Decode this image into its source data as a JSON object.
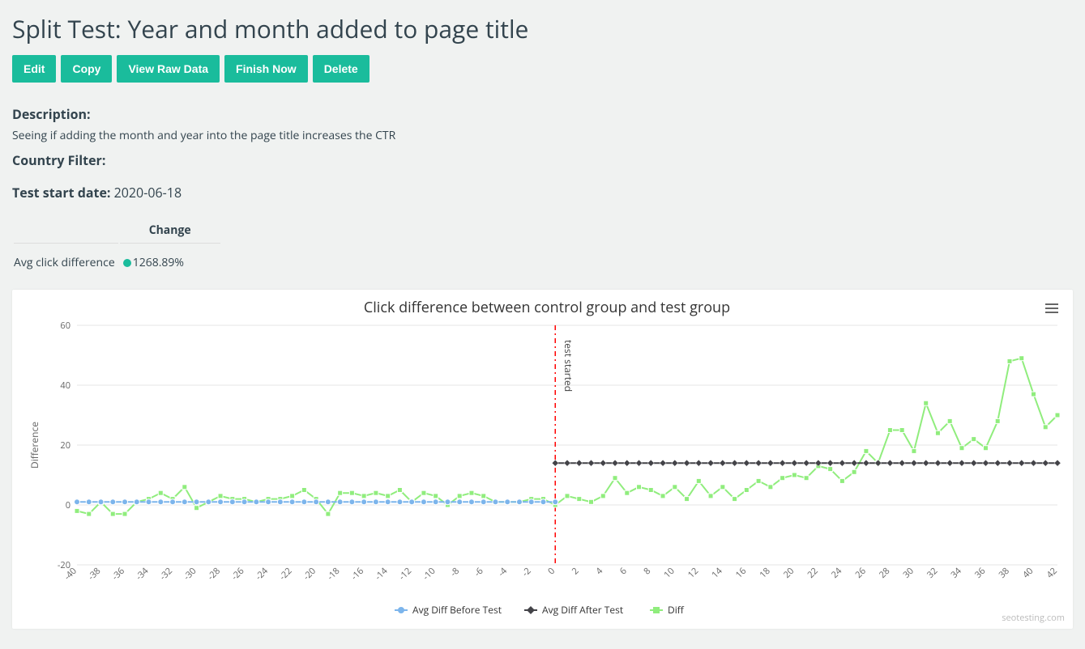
{
  "page_title": "Split Test: Year and month added to page title",
  "buttons": {
    "edit": "Edit",
    "copy": "Copy",
    "view_raw": "View Raw Data",
    "finish": "Finish Now",
    "delete": "Delete"
  },
  "description_label": "Description:",
  "description_text": "Seeing if adding the month and year into the page title increases the CTR",
  "country_filter_label": "Country Filter:",
  "country_filter_value": "",
  "start_date_label": "Test start date:",
  "start_date_value": "2020-06-18",
  "change_header": "Change",
  "avg_click_label": "Avg click difference",
  "avg_click_value": "1268.89%",
  "watermark": "seotesting.com",
  "chart_data": {
    "type": "line",
    "title": "Click difference between control group and test group",
    "ylabel": "Difference",
    "ylim": [
      -20,
      60
    ],
    "y_ticks": [
      -20,
      0,
      20,
      40,
      60
    ],
    "x": [
      -40,
      -39,
      -38,
      -37,
      -36,
      -35,
      -34,
      -33,
      -32,
      -31,
      -30,
      -29,
      -28,
      -27,
      -26,
      -25,
      -24,
      -23,
      -22,
      -21,
      -20,
      -19,
      -18,
      -17,
      -16,
      -15,
      -14,
      -13,
      -12,
      -11,
      -10,
      -9,
      -8,
      -7,
      -6,
      -5,
      -4,
      -3,
      -2,
      -1,
      0,
      1,
      2,
      3,
      4,
      5,
      6,
      7,
      8,
      9,
      10,
      11,
      12,
      13,
      14,
      15,
      16,
      17,
      18,
      19,
      20,
      21,
      22,
      23,
      24,
      25,
      26,
      27,
      28,
      29,
      30,
      31,
      32,
      33,
      34,
      35,
      36,
      37,
      38,
      39,
      40,
      41,
      42
    ],
    "x_tick_labels": [
      "-40",
      "",
      "-38",
      "",
      "-36",
      "",
      "-34",
      "",
      "-32",
      "",
      "-30",
      "",
      "-28",
      "",
      "-26",
      "",
      "-24",
      "",
      "-22",
      "",
      "-20",
      "",
      "-18",
      "",
      "-16",
      "",
      "-14",
      "",
      "-12",
      "",
      "-10",
      "",
      "-8",
      "",
      "-6",
      "",
      "-4",
      "",
      "-2",
      "",
      "0",
      "",
      "2",
      "",
      "4",
      "",
      "6",
      "",
      "8",
      "",
      "10",
      "",
      "12",
      "",
      "14",
      "",
      "16",
      "",
      "18",
      "",
      "20",
      "",
      "22",
      "",
      "24",
      "",
      "26",
      "",
      "28",
      "",
      "30",
      "",
      "32",
      "",
      "34",
      "",
      "36",
      "",
      "38",
      "",
      "40",
      "",
      "42"
    ],
    "series": [
      {
        "name": "Avg Diff Before Test",
        "color": "#7cb5ec",
        "marker": "circle",
        "range": [
          -40,
          0
        ],
        "value": 1
      },
      {
        "name": "Avg Diff After Test",
        "color": "#434348",
        "marker": "diamond",
        "range": [
          0,
          42
        ],
        "value": 14
      },
      {
        "name": "Diff",
        "color": "#90ed7d",
        "marker": "square",
        "values": [
          -2,
          -3,
          1,
          -3,
          -3,
          1,
          2,
          4,
          2,
          6,
          -1,
          1,
          3,
          2,
          2,
          1,
          2,
          2,
          3,
          5,
          2,
          -3,
          4,
          4,
          3,
          4,
          3,
          5,
          1,
          4,
          3,
          0,
          3,
          4,
          3,
          1,
          1,
          1,
          2,
          2,
          0,
          3,
          2,
          1,
          3,
          9,
          4,
          6,
          5,
          3,
          6,
          2,
          8,
          3,
          6,
          2,
          5,
          8,
          6,
          9,
          10,
          9,
          13,
          12,
          8,
          11,
          18,
          14,
          25,
          25,
          18,
          34,
          24,
          28,
          19,
          22,
          19,
          28,
          48,
          49,
          37,
          26,
          30
        ]
      }
    ],
    "annotation": {
      "x": 0,
      "label": "test started",
      "color": "#ff0000"
    },
    "legend_labels": {
      "before": "Avg Diff Before Test",
      "after": "Avg Diff After Test",
      "diff": "Diff"
    }
  }
}
